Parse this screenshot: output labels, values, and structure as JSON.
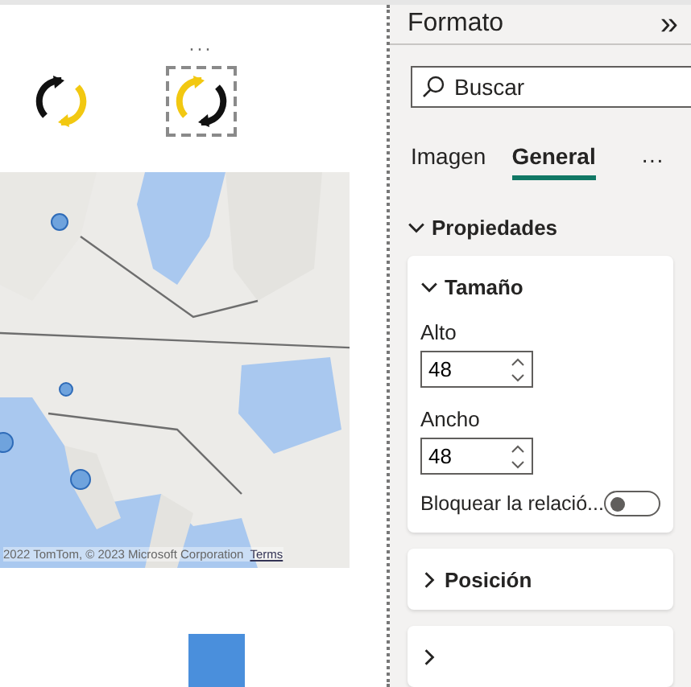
{
  "canvas": {
    "more_menu": "···",
    "visuals": [
      {
        "kind": "icon",
        "selected": false
      },
      {
        "kind": "icon",
        "selected": true
      }
    ],
    "map": {
      "kind": "picture",
      "attribution": "2022 TomTom, © 2023 Microsoft Corporation",
      "terms_link": "Terms"
    }
  },
  "pane": {
    "title": "Formato",
    "collapse": "»",
    "search": {
      "placeholder": "Buscar"
    },
    "tabs": [
      {
        "label": "Imagen",
        "selected": false
      },
      {
        "label": "General",
        "selected": true
      }
    ],
    "more_tabs": "···",
    "section": {
      "label": "Propiedades",
      "expanded": true
    },
    "cards": [
      {
        "label": "Tamaño",
        "expanded": true,
        "fields": [
          {
            "label": "Alto",
            "value": "48"
          },
          {
            "label": "Ancho",
            "value": "48"
          }
        ],
        "toggle": {
          "label": "Bloquear la relació...",
          "on": false
        }
      },
      {
        "label": "Posición",
        "expanded": false
      },
      {
        "expanded": false
      }
    ]
  }
}
